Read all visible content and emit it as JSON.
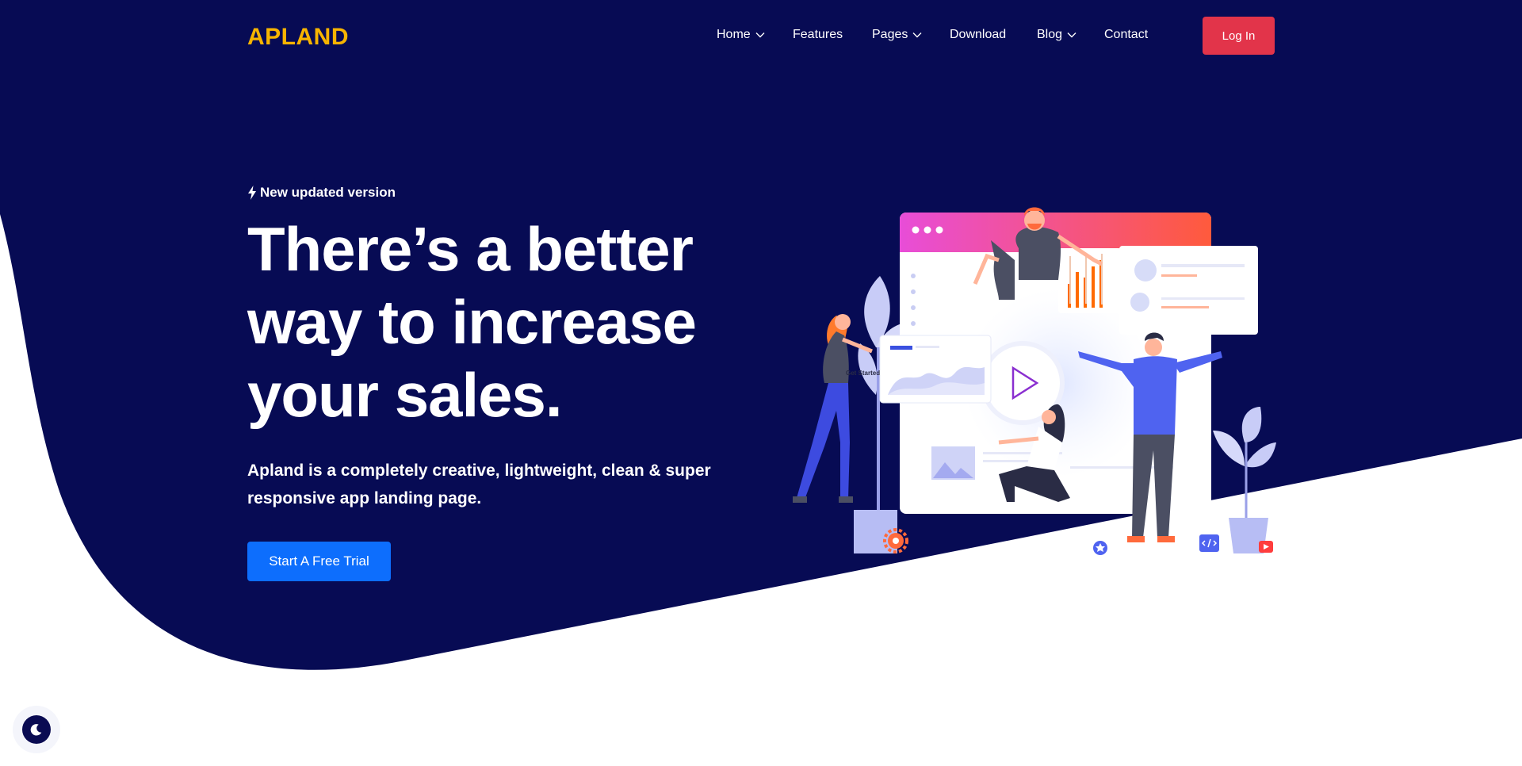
{
  "colors": {
    "hero_bg": "#070b54",
    "brand": "#f7b400",
    "login_bg": "#e2344a",
    "cta_bg": "#0d6efd",
    "text": "#ffffff"
  },
  "brand": {
    "name": "APLAND"
  },
  "nav": {
    "items": [
      {
        "label": "Home",
        "has_dropdown": true
      },
      {
        "label": "Features",
        "has_dropdown": false
      },
      {
        "label": "Pages",
        "has_dropdown": true
      },
      {
        "label": "Download",
        "has_dropdown": false
      },
      {
        "label": "Blog",
        "has_dropdown": true
      },
      {
        "label": "Contact",
        "has_dropdown": false
      }
    ],
    "login_label": "Log In"
  },
  "hero": {
    "badge_icon": "bolt-icon",
    "badge": "New updated version",
    "headline_lines": [
      "There’s a better",
      "way to increase",
      "your sales."
    ],
    "subtext_lines": [
      "Apland is a completely creative, lightweight, clean & super",
      "responsive app landing page."
    ],
    "cta_label": "Start A Free Trial"
  },
  "illustration": {
    "button_text": "Get Started",
    "icons": [
      "play-icon",
      "check-icon",
      "gear-icon",
      "star-icon",
      "code-icon",
      "youtube-icon"
    ]
  },
  "theme_toggle": {
    "icon": "moon-icon"
  }
}
